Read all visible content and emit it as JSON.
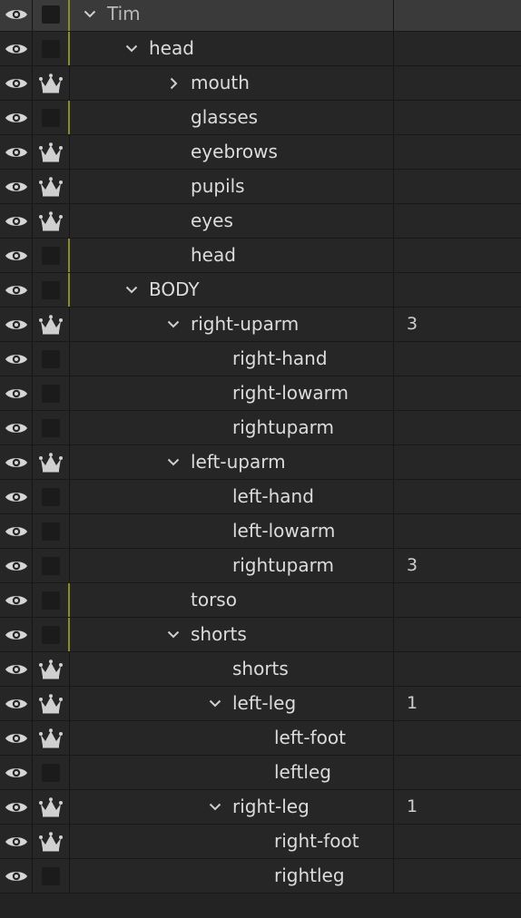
{
  "layers": [
    {
      "name": "Tim",
      "level": 0,
      "expander": "open",
      "swatch": "box-marked",
      "value": "",
      "selected": true
    },
    {
      "name": "head",
      "level": 1,
      "expander": "open",
      "swatch": "box-marked",
      "value": ""
    },
    {
      "name": "mouth",
      "level": 2,
      "expander": "closed",
      "swatch": "crown",
      "value": ""
    },
    {
      "name": "glasses",
      "level": 2,
      "expander": "none",
      "swatch": "box-marked",
      "value": ""
    },
    {
      "name": "eyebrows",
      "level": 2,
      "expander": "none",
      "swatch": "crown",
      "value": ""
    },
    {
      "name": "pupils",
      "level": 2,
      "expander": "none",
      "swatch": "crown",
      "value": ""
    },
    {
      "name": "eyes",
      "level": 2,
      "expander": "none",
      "swatch": "crown",
      "value": ""
    },
    {
      "name": "head",
      "level": 2,
      "expander": "none",
      "swatch": "box-marked",
      "value": ""
    },
    {
      "name": "BODY",
      "level": 1,
      "expander": "open",
      "swatch": "box-marked",
      "value": ""
    },
    {
      "name": "right-uparm",
      "level": 2,
      "expander": "open",
      "swatch": "crown",
      "value": "3"
    },
    {
      "name": "right-hand",
      "level": 3,
      "expander": "none",
      "swatch": "box",
      "value": ""
    },
    {
      "name": "right-lowarm",
      "level": 3,
      "expander": "none",
      "swatch": "box",
      "value": ""
    },
    {
      "name": "rightuparm",
      "level": 3,
      "expander": "none",
      "swatch": "box",
      "value": ""
    },
    {
      "name": "left-uparm",
      "level": 2,
      "expander": "open",
      "swatch": "crown",
      "value": ""
    },
    {
      "name": "left-hand",
      "level": 3,
      "expander": "none",
      "swatch": "box",
      "value": ""
    },
    {
      "name": "left-lowarm",
      "level": 3,
      "expander": "none",
      "swatch": "box",
      "value": ""
    },
    {
      "name": "rightuparm",
      "level": 3,
      "expander": "none",
      "swatch": "box",
      "value": "3"
    },
    {
      "name": "torso",
      "level": 2,
      "expander": "none",
      "swatch": "box-marked",
      "value": ""
    },
    {
      "name": "shorts",
      "level": 2,
      "expander": "open",
      "swatch": "box-marked",
      "value": ""
    },
    {
      "name": "shorts",
      "level": 3,
      "expander": "none",
      "swatch": "crown",
      "value": ""
    },
    {
      "name": "left-leg",
      "level": 3,
      "expander": "open",
      "swatch": "crown",
      "value": "1"
    },
    {
      "name": "left-foot",
      "level": 4,
      "expander": "none",
      "swatch": "crown",
      "value": ""
    },
    {
      "name": "leftleg",
      "level": 4,
      "expander": "none",
      "swatch": "box",
      "value": ""
    },
    {
      "name": "right-leg",
      "level": 3,
      "expander": "open",
      "swatch": "crown",
      "value": "1"
    },
    {
      "name": "right-foot",
      "level": 4,
      "expander": "none",
      "swatch": "crown",
      "value": ""
    },
    {
      "name": "rightleg",
      "level": 4,
      "expander": "none",
      "swatch": "box",
      "value": ""
    }
  ],
  "icons": {
    "visibility": "eye-icon",
    "bone": "crown-icon",
    "expand": "chevron-down-icon",
    "collapsed": "chevron-right-icon"
  }
}
